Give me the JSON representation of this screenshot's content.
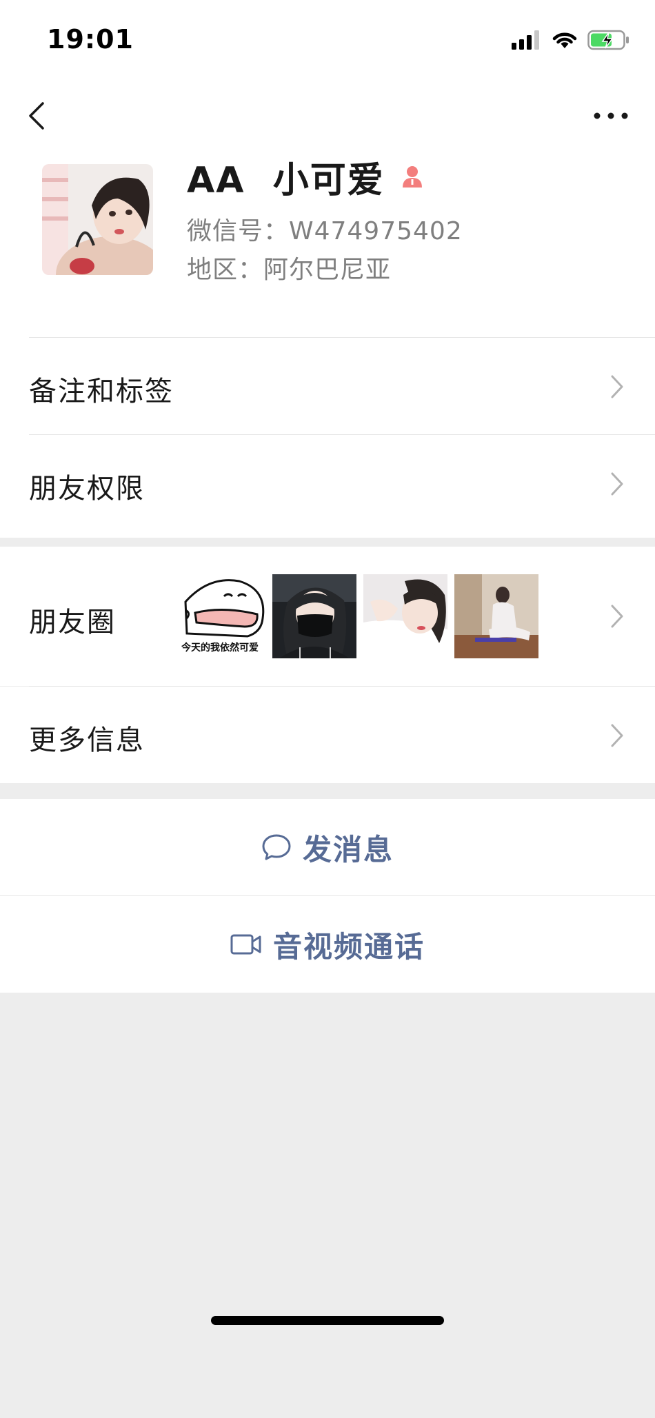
{
  "status_bar": {
    "time": "19:01",
    "icons": [
      "signal-icon",
      "wifi-icon",
      "battery-charging-icon"
    ],
    "battery_color": "#4cd964"
  },
  "nav": {
    "back_icon": "chevron-left-icon",
    "more_icon": "ellipsis-icon"
  },
  "profile": {
    "nickname": "AA  小可爱",
    "gender_icon": "female-icon",
    "gender_color": "#f37e7d",
    "wechat_id": "微信号：W474975402",
    "region": "地区：阿尔巴尼亚"
  },
  "cells": {
    "remark_tags": "备注和标签",
    "friend_permissions": "朋友权限",
    "moments": "朋友圈",
    "more_info": "更多信息"
  },
  "moments_thumbnails": {
    "first_caption": "今天的我依然可爱"
  },
  "actions": {
    "send_message": "发消息",
    "send_message_icon": "chat-bubble-icon",
    "video_call": "音视频通话",
    "video_call_icon": "video-camera-icon",
    "accent_color": "#576b95"
  }
}
